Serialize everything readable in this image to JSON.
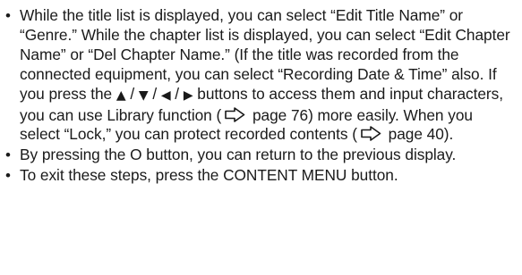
{
  "bullet_symbol": "•",
  "bullets": [
    {
      "parts": [
        "While the title list is displayed, you can select “Edit Title Name” or “Genre.” While the chapter list is displayed, you can select “Edit Chapter Name” or “Del Chapter Name.” (If the title was recorded from the connected equipment, you can select “Recording Date & Time” also. If you press the ",
        "▲",
        " / ",
        "▼",
        " / ",
        "◀",
        " / ",
        "▶",
        " buttons to access them and input characters, you can use Library function (",
        " page 76) more easily. When you select “Lock,” you can protect recorded contents (",
        " page 40)."
      ]
    },
    {
      "text": "By pressing the O button, you can return to the previous display."
    },
    {
      "text": "To exit these steps, press the CONTENT MENU button."
    }
  ],
  "icons": {
    "page_reference": "page-reference-arrow-icon"
  },
  "colors": {
    "text": "#1a1a1a",
    "arrow_fill": "#ffffff",
    "arrow_stroke": "#1a1a1a"
  }
}
